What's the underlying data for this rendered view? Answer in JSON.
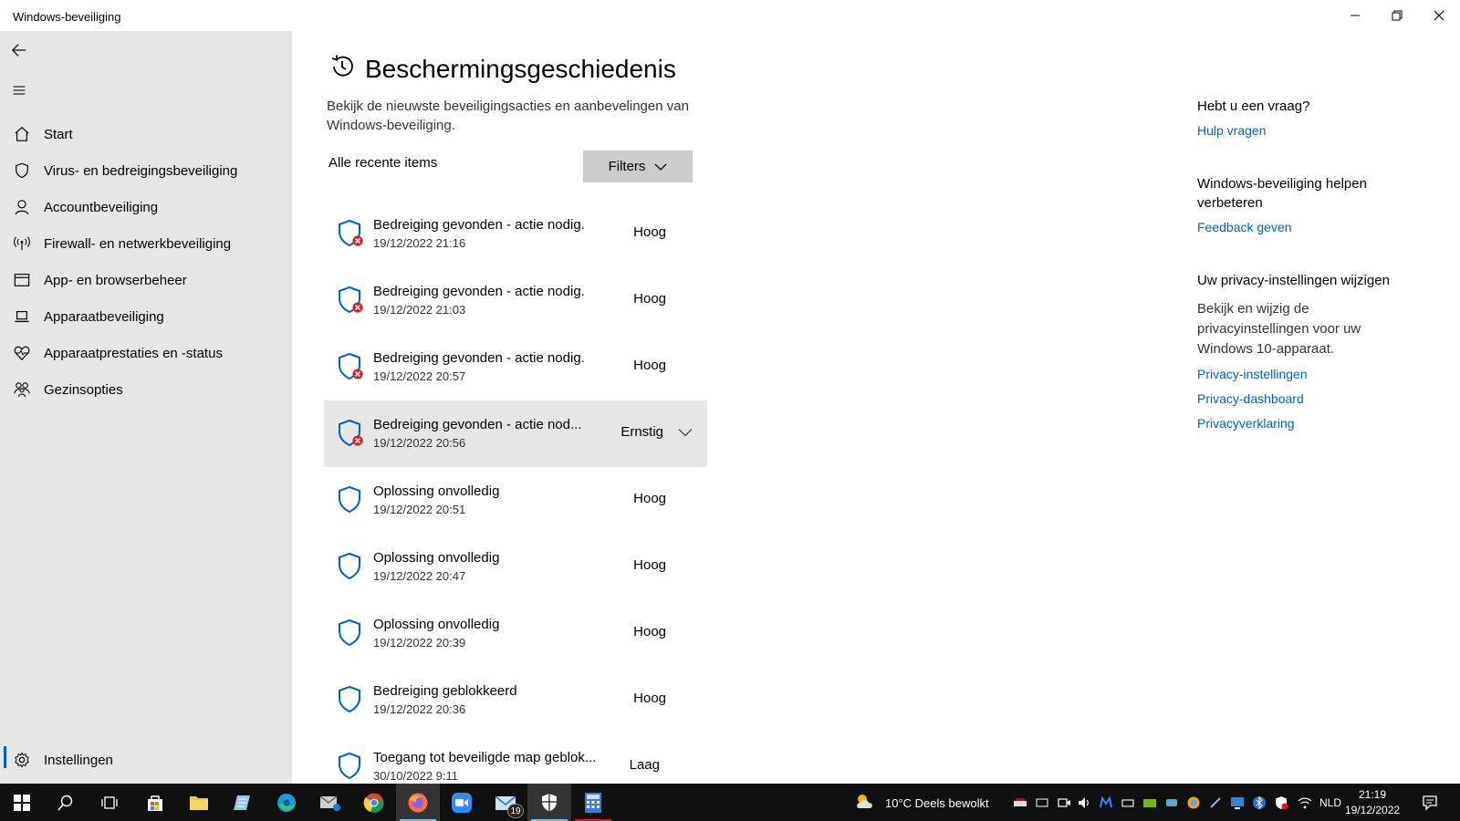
{
  "window": {
    "title": "Windows-beveiliging"
  },
  "sidebar": {
    "items": [
      {
        "label": "Start",
        "icon": "home-icon"
      },
      {
        "label": "Virus- en bedreigingsbeveiliging",
        "icon": "shield-icon"
      },
      {
        "label": "Accountbeveiliging",
        "icon": "person-icon"
      },
      {
        "label": "Firewall- en netwerkbeveiliging",
        "icon": "antenna-icon"
      },
      {
        "label": "App- en browserbeheer",
        "icon": "browser-window-icon"
      },
      {
        "label": "Apparaatbeveiliging",
        "icon": "laptop-icon"
      },
      {
        "label": "Apparaatprestaties en -status",
        "icon": "heart-pulse-icon"
      },
      {
        "label": "Gezinsopties",
        "icon": "family-icon"
      }
    ],
    "settings_label": "Instellingen"
  },
  "main": {
    "title": "Beschermingsgeschiedenis",
    "description": "Bekijk de nieuwste beveiligingsacties en aanbevelingen van Windows-beveiliging.",
    "recent_label": "Alle recente items",
    "filters_label": "Filters",
    "items": [
      {
        "title": "Bedreiging gevonden - actie nodig.",
        "date": "19/12/2022 21:16",
        "severity": "Hoog",
        "alert": true
      },
      {
        "title": "Bedreiging gevonden - actie nodig.",
        "date": "19/12/2022 21:03",
        "severity": "Hoog",
        "alert": true
      },
      {
        "title": "Bedreiging gevonden - actie nodig.",
        "date": "19/12/2022 20:57",
        "severity": "Hoog",
        "alert": true
      },
      {
        "title": "Bedreiging gevonden - actie nod...",
        "date": "19/12/2022 20:56",
        "severity": "Ernstig",
        "alert": true,
        "selected": true
      },
      {
        "title": "Oplossing onvolledig",
        "date": "19/12/2022 20:51",
        "severity": "Hoog",
        "alert": false
      },
      {
        "title": "Oplossing onvolledig",
        "date": "19/12/2022 20:47",
        "severity": "Hoog",
        "alert": false
      },
      {
        "title": "Oplossing onvolledig",
        "date": "19/12/2022 20:39",
        "severity": "Hoog",
        "alert": false
      },
      {
        "title": "Bedreiging geblokkeerd",
        "date": "19/12/2022 20:36",
        "severity": "Hoog",
        "alert": false
      },
      {
        "title": "Toegang tot beveiligde map geblok...",
        "date": "30/10/2022 9:11",
        "severity": "Laag",
        "alert": false
      }
    ]
  },
  "aside": {
    "question_heading": "Hebt u een vraag?",
    "help_link": "Hulp vragen",
    "improve_heading": "Windows-beveiliging helpen verbeteren",
    "feedback_link": "Feedback geven",
    "privacy_heading": "Uw privacy-instellingen wijzigen",
    "privacy_text": "Bekijk en wijzig de privacyinstellingen voor uw Windows 10-apparaat.",
    "privacy_links": [
      "Privacy-instellingen",
      "Privacy-dashboard",
      "Privacyverklaring"
    ]
  },
  "taskbar": {
    "weather": "10°C  Deels bewolkt",
    "mail_badge": "19",
    "language": "NLD",
    "time": "21:19",
    "date": "19/12/2022"
  },
  "colors": {
    "accent": "#0063b1",
    "shield": "#0063b1",
    "alert": "#e81123",
    "sidebar_bg": "#e6e6e6"
  }
}
